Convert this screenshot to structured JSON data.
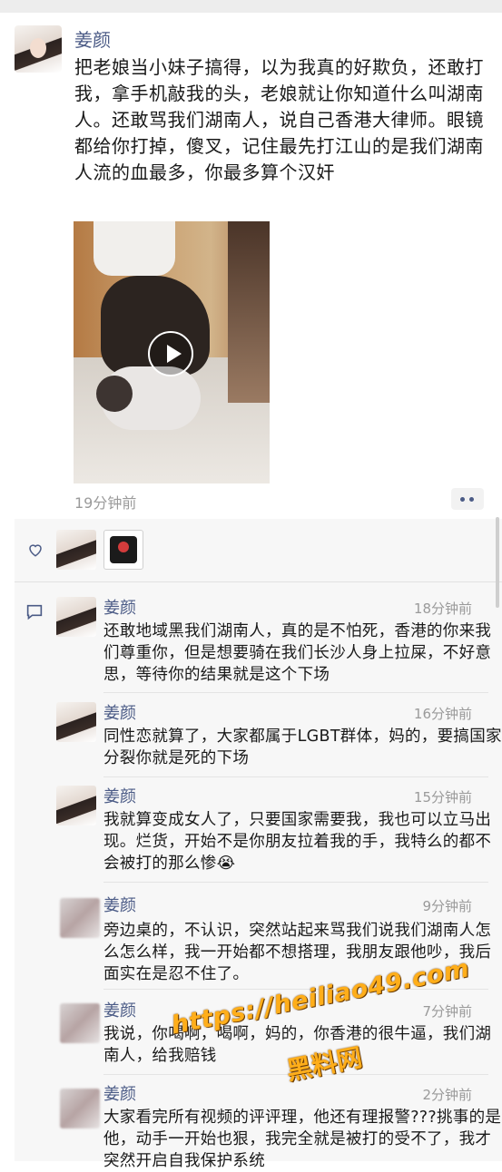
{
  "post": {
    "author": "姜颜",
    "text": "把老娘当小妹子搞得，以为我真的好欺负，还敢打我，拿手机敲我的头，老娘就让你知道什么叫湖南人。还敢骂我们湖南人，说自己香港大律师。眼镜都给你打掉，傻叉，记住最先打江山的是我们湖南人流的血最多，你最多算个汉奸",
    "time": "19分钟前"
  },
  "comments": [
    {
      "author": "姜颜",
      "time": "18分钟前",
      "text": "还敢地域黑我们湖南人，真的是不怕死，香港的你来我们尊重你，但是想要骑在我们长沙人身上拉屎，不好意思，等待你的结果就是这个下场"
    },
    {
      "author": "姜颜",
      "time": "16分钟前",
      "text": "同性恋就算了，大家都属于LGBT群体，妈的，要搞国家分裂你就是死的下场"
    },
    {
      "author": "姜颜",
      "time": "15分钟前",
      "text": "我就算变成女人了，只要国家需要我，我也可以立马出现。烂货，开始不是你朋友拉着我的手，我特么的都不会被打的那么惨😭"
    },
    {
      "author": "姜颜",
      "time": "9分钟前",
      "text": "旁边桌的，不认识，突然站起来骂我们说我们湖南人怎么怎么样，我一开始都不想搭理，我朋友跟他吵，我后面实在是忍不住了。"
    },
    {
      "author": "姜颜",
      "time": "7分钟前",
      "text": "我说，你喝啊，喝啊，妈的，你香港的很牛逼，我们湖南人，给我赔钱"
    },
    {
      "author": "姜颜",
      "time": "2分钟前",
      "text": "大家看完所有视频的评评理，他还有理报警???挑事的是他，动手一开始也狠，我完全就是被打的受不了，我才突然开启自我保护系统"
    }
  ],
  "watermark": {
    "url": "https://heiliao49.com",
    "site": "黑料网"
  },
  "colors": {
    "name_link": "#4b5b86",
    "time_gray": "#9a9a9a",
    "comment_bg": "#f7f7f7",
    "watermark": "#ffae1a"
  },
  "icons": [
    "heart-icon",
    "comment-icon",
    "play-icon",
    "more-icon"
  ]
}
